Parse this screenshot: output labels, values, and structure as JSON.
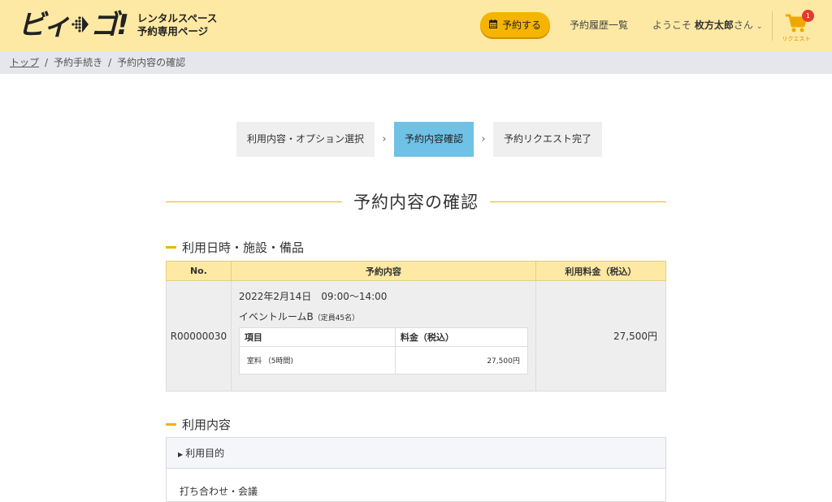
{
  "header": {
    "logo_mark_left": "ビィ",
    "logo_mark_right": "ゴ!",
    "logo_line1": "レンタルスペース",
    "logo_line2": "予約専用ページ",
    "reserve_button": "予約する",
    "history_link": "予約履歴一覧",
    "welcome_prefix": "ようこそ ",
    "user_name": "枚方太郎",
    "welcome_suffix": "さん",
    "cart_label": "リクエスト",
    "cart_count": "1"
  },
  "breadcrumb": {
    "items": [
      "トップ",
      "予約手続き",
      "予約内容の確認"
    ]
  },
  "steps": [
    {
      "label": "利用内容・オプション選択",
      "active": false
    },
    {
      "label": "予約内容確認",
      "active": true
    },
    {
      "label": "予約リクエスト完了",
      "active": false
    }
  ],
  "page_title": "予約内容の確認",
  "section1": {
    "title": "利用日時・施設・備品",
    "columns": [
      "No.",
      "予約内容",
      "利用料金（税込）"
    ],
    "row": {
      "no": "R00000030",
      "datetime": "2022年2月14日　09:00〜14:00",
      "room": "イベントルームB",
      "capacity": "（定員45名）",
      "inner_headers": [
        "項目",
        "料金（税込）"
      ],
      "inner_item": "室料 （5時間)",
      "inner_fee": "27,500円",
      "fee": "27,500円"
    }
  },
  "section2": {
    "title": "利用内容",
    "purpose_label": "利用目的",
    "purpose_value": "打ち合わせ・会議"
  }
}
